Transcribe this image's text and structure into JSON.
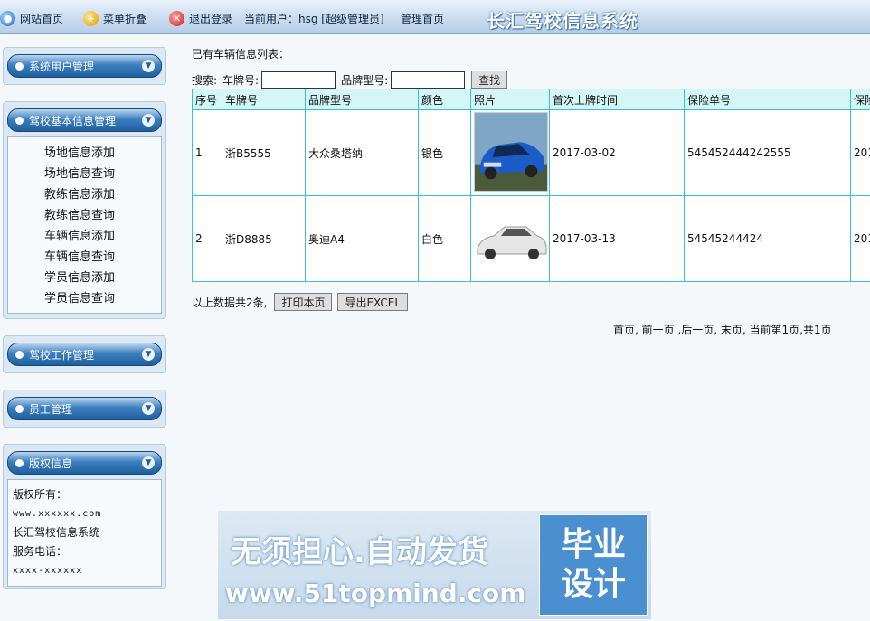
{
  "topbar": {
    "site_home": "网站首页",
    "menu_fold": "菜单折叠",
    "logout": "退出登录",
    "current_user": "当前用户：hsg [超级管理员]",
    "admin_home": "管理首页",
    "system_title": "长汇驾校信息系统"
  },
  "sidebar": {
    "user_mgmt": {
      "title": "系统用户管理"
    },
    "basic_info": {
      "title": "驾校基本信息管理",
      "items": [
        "场地信息添加",
        "场地信息查询",
        "教练信息添加",
        "教练信息查询",
        "车辆信息添加",
        "车辆信息查询",
        "学员信息添加",
        "学员信息查询"
      ]
    },
    "work_mgmt": {
      "title": "驾校工作管理"
    },
    "staff_mgmt": {
      "title": "员工管理"
    },
    "copyright": {
      "title": "版权信息",
      "owner_label": "版权所有：",
      "website": "www.xxxxxx.com",
      "system_name": "长汇驾校信息系统",
      "phone_label": "服务电话：",
      "phone": "xxxx-xxxxxx"
    }
  },
  "main": {
    "list_title": "已有车辆信息列表：",
    "search": {
      "label": "搜索:",
      "plate_label": "车牌号:",
      "plate_value": "",
      "model_label": "品牌型号:",
      "model_value": "",
      "button": "查找"
    },
    "table": {
      "headers": [
        "序号",
        "车牌号",
        "品牌型号",
        "颜色",
        "照片",
        "首次上牌时间",
        "保险单号",
        "保险"
      ],
      "rows": [
        {
          "no": "1",
          "plate": "浙B5555",
          "model": "大众桑塔纳",
          "color": "银色",
          "photo": "blue-sedan-photo",
          "first_reg": "2017-03-02",
          "policy": "545452444242555",
          "extra": "201"
        },
        {
          "no": "2",
          "plate": "浙D8885",
          "model": "奥迪A4",
          "color": "白色",
          "photo": "white-sedan-photo",
          "first_reg": "2017-03-13",
          "policy": "54545244424",
          "extra": "201"
        }
      ]
    },
    "summary": {
      "text": "以上数据共2条,",
      "print_button": "打印本页",
      "export_button": "导出EXCEL"
    },
    "pager": "首页, 前一页 ,后一页, 末页, 当前第1页,共1页"
  },
  "watermark": {
    "line1": "无须担心.自动发货",
    "line2": "www.51topmind.com",
    "box_line1": "毕业",
    "box_line2": "设计"
  },
  "colors": {
    "table_border": "#35c3d3",
    "header_bg": "#d5f6f7",
    "panel_head": "#1f5f9e",
    "page_bg": "#f4f8fb"
  }
}
